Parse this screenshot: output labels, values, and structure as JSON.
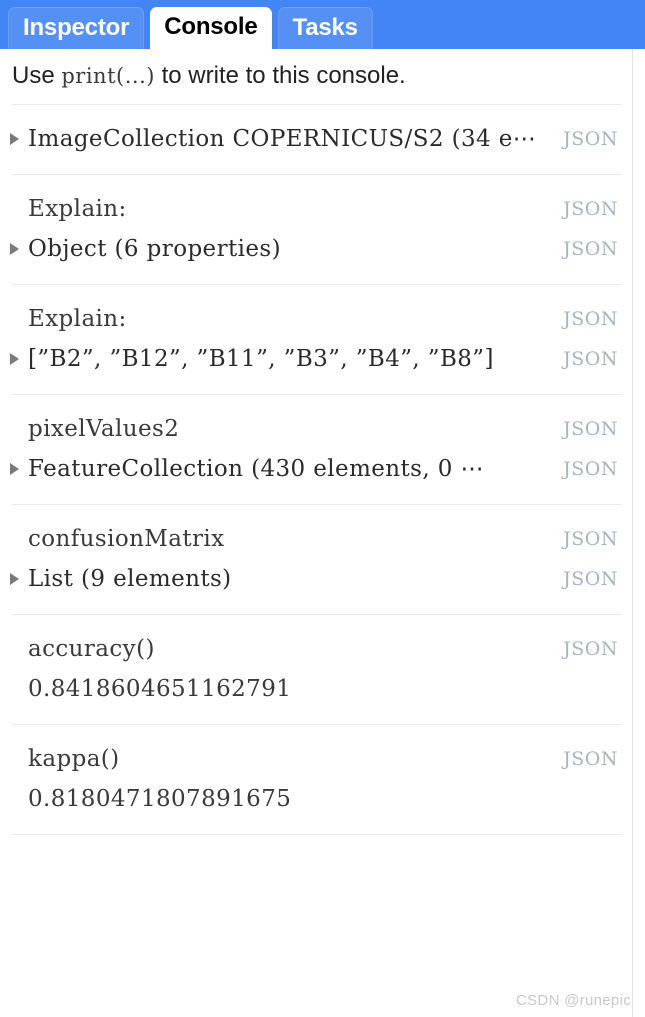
{
  "tabs": [
    {
      "label": "Inspector",
      "active": false
    },
    {
      "label": "Console",
      "active": true
    },
    {
      "label": "Tasks",
      "active": false
    }
  ],
  "colors": {
    "tabbar_blue": "#4285f4",
    "tab_inactive_blue": "#5591f5",
    "json_link": "#a8b4c4",
    "divider": "#ebebeb",
    "text": "#2b2b2b"
  },
  "hint": {
    "prefix": "Use ",
    "code": "print(...)",
    "suffix": " to write to this console."
  },
  "json_label": "JSON",
  "entries": [
    {
      "lines": [
        {
          "arrow": true,
          "text": "ImageCollection COPERNICUS/S2 (34 e⋯",
          "json": true
        }
      ]
    },
    {
      "lines": [
        {
          "arrow": false,
          "text": "Explain:",
          "json": true
        },
        {
          "arrow": true,
          "text": "Object (6 properties)",
          "json": true
        }
      ]
    },
    {
      "lines": [
        {
          "arrow": false,
          "text": "Explain:",
          "json": true
        },
        {
          "arrow": true,
          "text": "[”B2”, ”B12”, ”B11”, ”B3”, ”B4”, ”B8”]",
          "json": true
        }
      ]
    },
    {
      "lines": [
        {
          "arrow": false,
          "text": "pixelValues2",
          "json": true
        },
        {
          "arrow": true,
          "text": "FeatureCollection (430 elements, 0 ⋯",
          "json": true
        }
      ]
    },
    {
      "lines": [
        {
          "arrow": false,
          "text": "confusionMatrix",
          "json": true
        },
        {
          "arrow": true,
          "text": "List (9 elements)",
          "json": true
        }
      ]
    },
    {
      "lines": [
        {
          "arrow": false,
          "text": "accuracy()",
          "json": true
        },
        {
          "arrow": false,
          "text": "0.8418604651162791",
          "json": false
        }
      ]
    },
    {
      "lines": [
        {
          "arrow": false,
          "text": "kappa()",
          "json": true
        },
        {
          "arrow": false,
          "text": "0.8180471807891675",
          "json": false
        }
      ]
    }
  ],
  "watermark": "CSDN @runepic"
}
